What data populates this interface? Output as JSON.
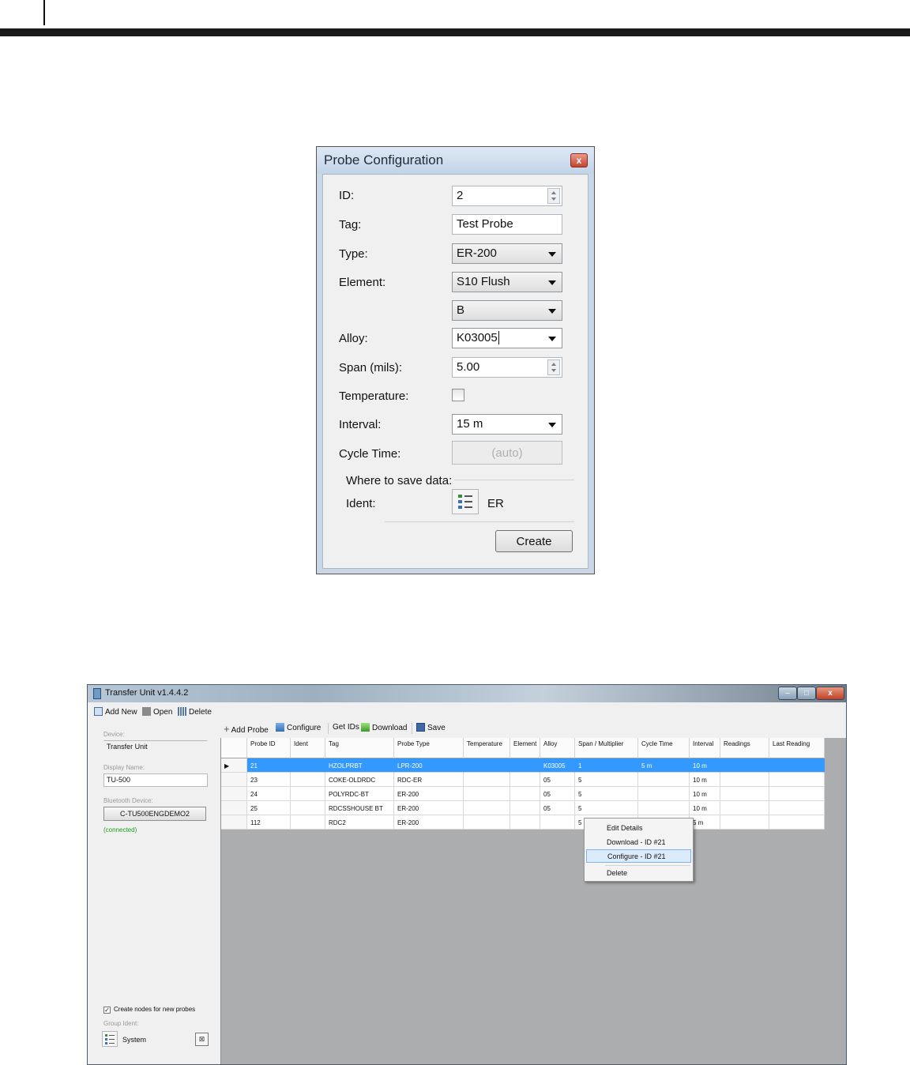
{
  "probe_dialog": {
    "title": "Probe Configuration",
    "close_glyph": "x",
    "fields": {
      "id_label": "ID:",
      "id_value": "2",
      "tag_label": "Tag:",
      "tag_value": "Test Probe",
      "type_label": "Type:",
      "type_value": "ER-200",
      "element_label": "Element:",
      "element_value": "S10 Flush",
      "element_sub_value": "B",
      "alloy_label": "Alloy:",
      "alloy_value": "K03005",
      "span_label": "Span (mils):",
      "span_value": "5.00",
      "temperature_label": "Temperature:",
      "temperature_checked": false,
      "interval_label": "Interval:",
      "interval_value": "15 m",
      "cycle_time_label": "Cycle Time:",
      "cycle_time_value": "(auto)"
    },
    "save_section": {
      "heading": "Where to save data:",
      "ident_label": "Ident:",
      "ident_value": "ER"
    },
    "create_label": "Create"
  },
  "transfer_window": {
    "title": "Transfer Unit v1.4.4.2",
    "window_buttons": {
      "minimize": "–",
      "maximize": "□",
      "close": "x"
    },
    "file_toolbar": {
      "add_new": "Add New",
      "open": "Open",
      "delete": "Delete"
    },
    "toolbar": {
      "add_probe": "Add Probe",
      "configure": "Configure",
      "get_ids": "Get IDs",
      "download": "Download",
      "save": "Save"
    },
    "sidebar": {
      "device_label": "Device:",
      "device_value": "Transfer Unit",
      "display_name_label": "Display Name:",
      "display_name_value": "TU-500",
      "bluetooth_label": "Bluetooth Device:",
      "bluetooth_value": "C-TU500ENGDEMO2",
      "status": "(connected)",
      "create_nodes_label": "Create nodes for new probes",
      "create_nodes_checked": true,
      "group_ident_label": "Group Ident:",
      "group_ident_value": "System"
    },
    "table": {
      "headers": [
        "Probe ID",
        "Ident",
        "Tag",
        "Probe Type",
        "Temperature",
        "Element",
        "Alloy",
        "Span / Multiplier",
        "Cycle Time",
        "Interval",
        "Readings",
        "Last Reading"
      ],
      "rows": [
        [
          "21",
          "",
          "HZOLPRBT",
          "LPR-200",
          "",
          "",
          "K03005",
          "1",
          "5 m",
          "10 m",
          "",
          ""
        ],
        [
          "23",
          "",
          "COKE-OLDRDC",
          "RDC-ER",
          "",
          "",
          "05",
          "5",
          "",
          "10 m",
          "",
          ""
        ],
        [
          "24",
          "",
          "POLYRDC-BT",
          "ER-200",
          "",
          "",
          "05",
          "5",
          "",
          "10 m",
          "",
          ""
        ],
        [
          "25",
          "",
          "RDCSSHOUSE BT",
          "ER-200",
          "",
          "",
          "05",
          "5",
          "",
          "10 m",
          "",
          ""
        ],
        [
          "112",
          "",
          "RDC2",
          "ER-200",
          "",
          "",
          "",
          "5",
          "",
          "5 m",
          "",
          ""
        ]
      ],
      "selected_row": 0
    },
    "context_menu": {
      "items": [
        "Edit Details",
        "Download - ID #21",
        "Configure - ID #21",
        "Delete"
      ],
      "highlighted": 2
    }
  }
}
